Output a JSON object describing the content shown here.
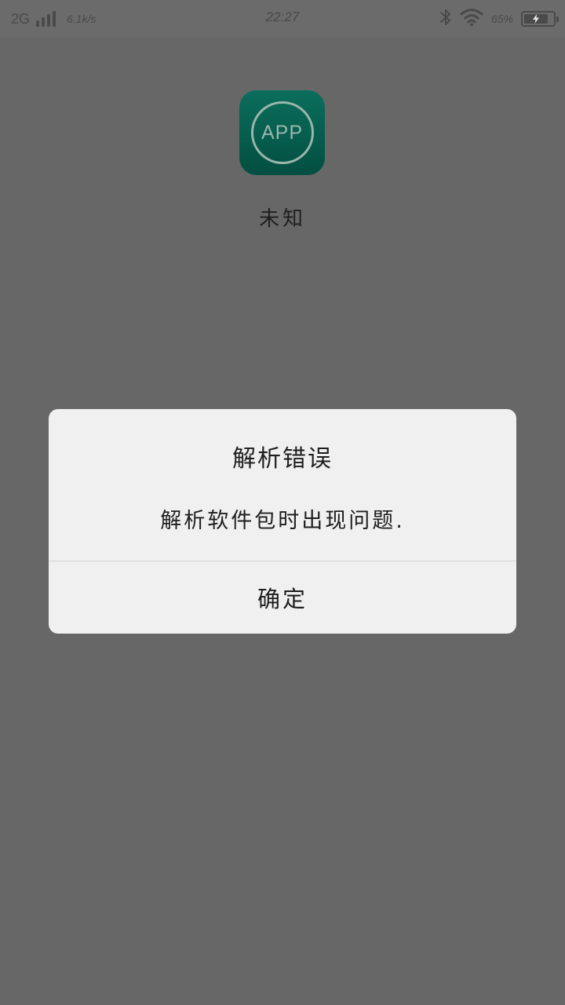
{
  "status_bar": {
    "network_type": "2G",
    "speed": "6.1k/s",
    "time": "22:27",
    "battery_percent": "65%",
    "icons": [
      "signal-icon",
      "bluetooth-icon",
      "wifi-icon",
      "battery-icon",
      "charging-bolt-icon"
    ]
  },
  "app": {
    "icon_text": "APP",
    "name": "未知",
    "icon_colors": {
      "top": "#0b6e5c",
      "bottom": "#034f41",
      "ring": "#9ab6ad"
    }
  },
  "dialog": {
    "title": "解析错误",
    "message": "解析软件包时出现问题.",
    "confirm_label": "确定"
  },
  "colors": {
    "background": "#676767",
    "dialog_background": "#f0f0f0",
    "text": "#1e1e1e"
  }
}
